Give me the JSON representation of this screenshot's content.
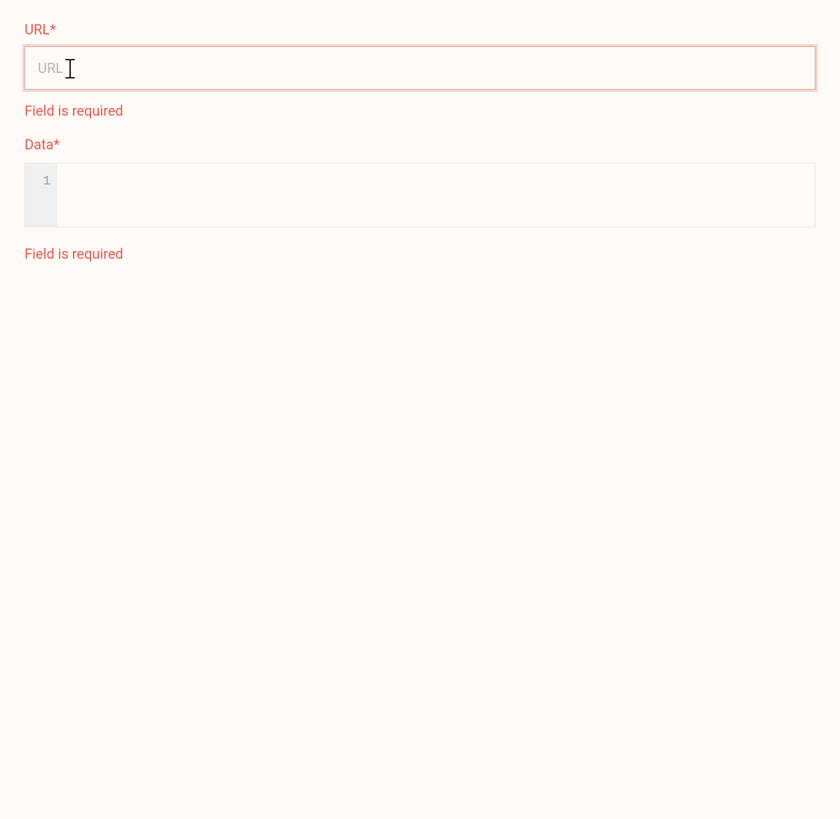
{
  "form": {
    "url": {
      "label": "URL*",
      "placeholder": "URL",
      "value": "",
      "error": "Field is required"
    },
    "data": {
      "label": "Data*",
      "line_number": "1",
      "value": "",
      "error": "Field is required"
    }
  }
}
